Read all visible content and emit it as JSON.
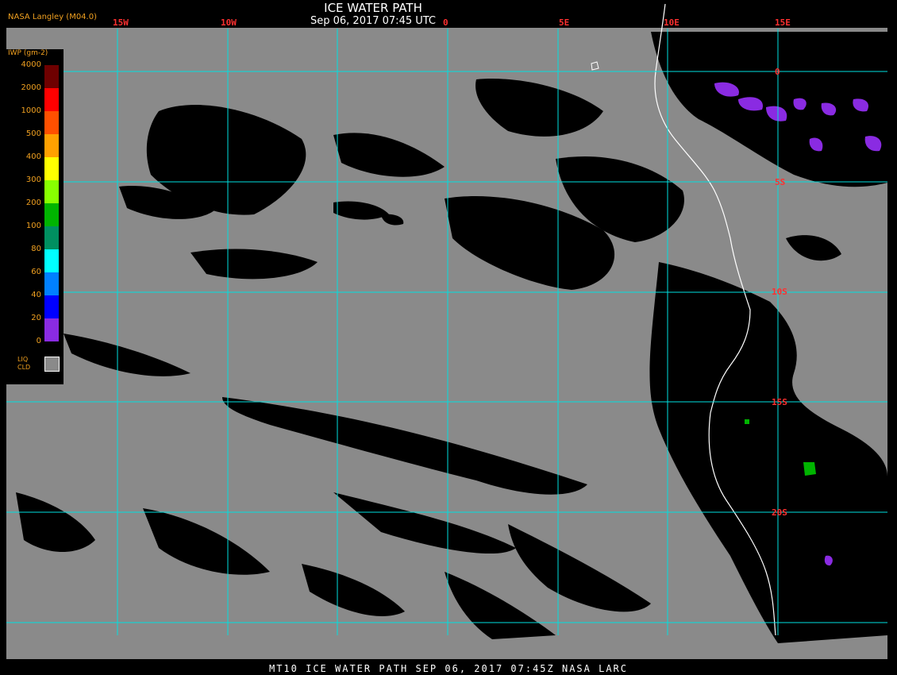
{
  "header": {
    "title": "ICE WATER PATH",
    "datetime": "Sep 06, 2017 07:45 UTC",
    "provider": "NASA Langley (M04.0)"
  },
  "grid": {
    "longitudes": [
      "15W",
      "10W",
      "0",
      "5E",
      "10E",
      "15E"
    ],
    "latitudes": [
      "0",
      "5S",
      "10S",
      "15S",
      "20S"
    ]
  },
  "legend": {
    "unit_label": "IWP (gm-2)",
    "levels": [
      {
        "label": "4000",
        "color": "#6e0000"
      },
      {
        "label": "2000",
        "color": "#ff0000"
      },
      {
        "label": "1000",
        "color": "#ff5000"
      },
      {
        "label": "500",
        "color": "#ffa000"
      },
      {
        "label": "400",
        "color": "#ffff00"
      },
      {
        "label": "300",
        "color": "#88ff00"
      },
      {
        "label": "200",
        "color": "#00b400"
      },
      {
        "label": "100",
        "color": "#009060"
      },
      {
        "label": "80",
        "color": "#00ffff"
      },
      {
        "label": "60",
        "color": "#0080ff"
      },
      {
        "label": "40",
        "color": "#0000ff"
      },
      {
        "label": "20",
        "color": "#8a2be2"
      },
      {
        "label": "0",
        "color": ""
      }
    ],
    "liquid_cloud_label": "LIQ CLD",
    "liquid_cloud_color": "#8a8a8a"
  },
  "colors": {
    "background_clear": "#000000",
    "liquid_cloud": "#8a8a8a",
    "gridlines": "#00e0e0",
    "coastline": "#ffffff",
    "grid_labels": "#ff3030",
    "legend_text": "#f0a020"
  },
  "footer": {
    "text": "MT10  ICE WATER PATH   SEP 06, 2017 07:45Z   NASA LARC"
  }
}
